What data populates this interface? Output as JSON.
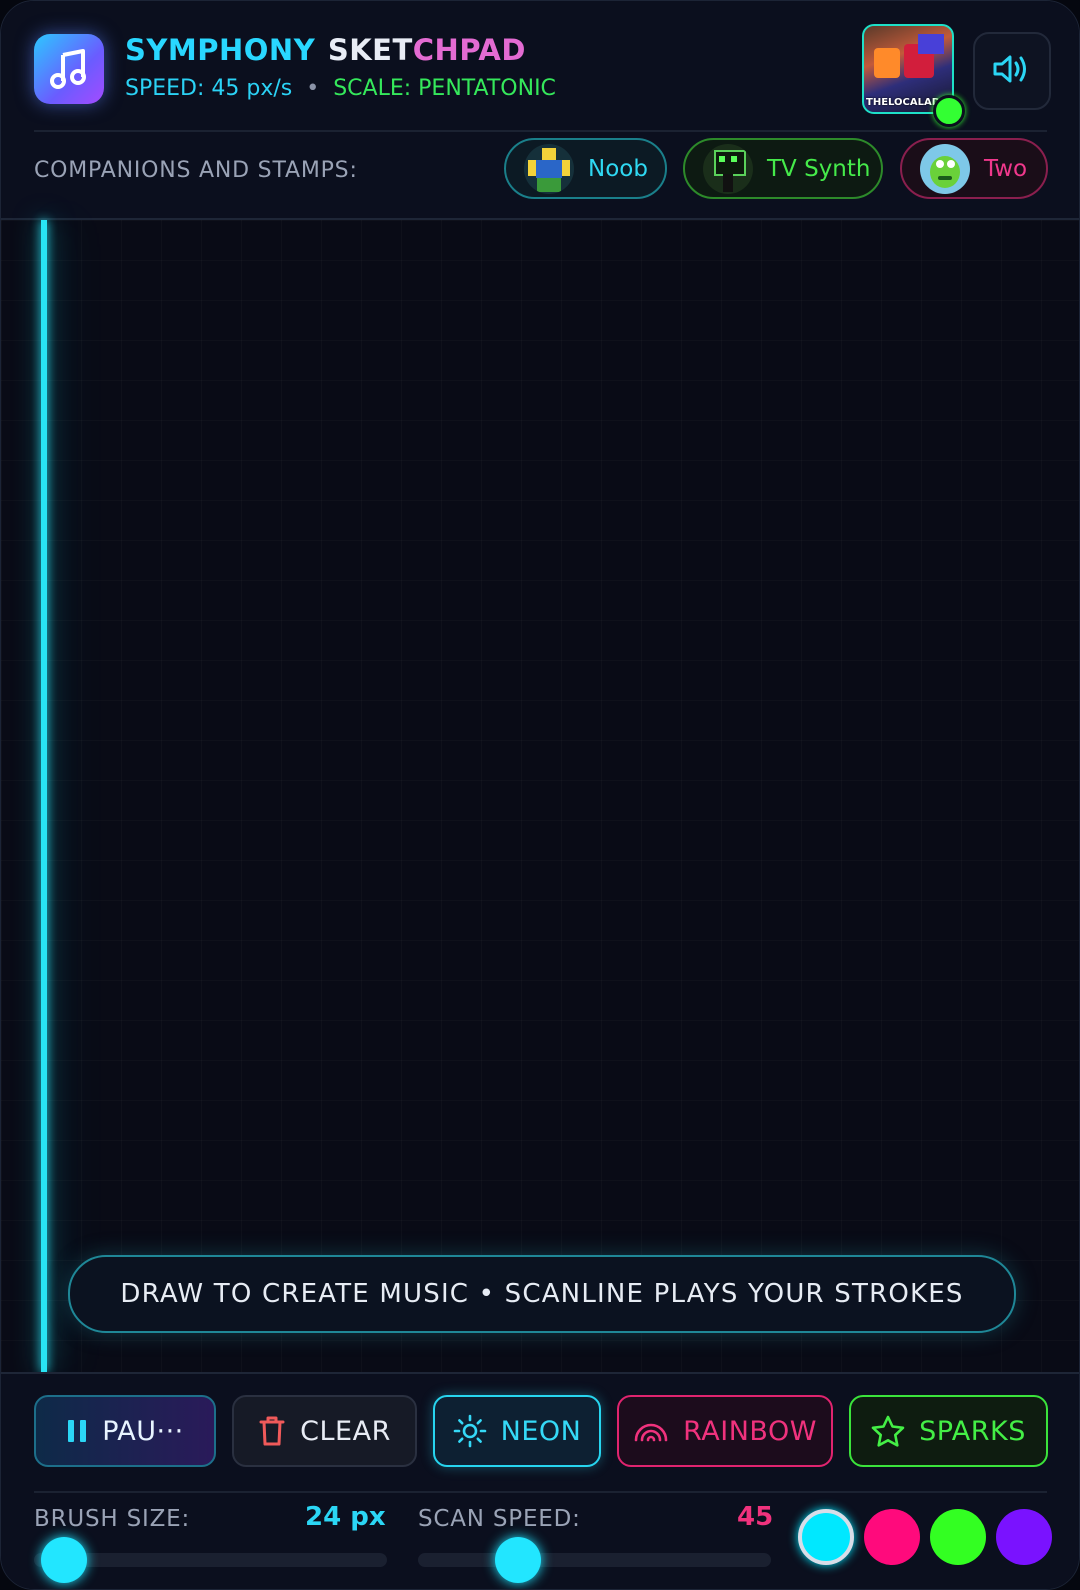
{
  "header": {
    "title_part1": "SYMPHONY",
    "title_part2": "SKET",
    "title_part3": "CHPAD",
    "speed": "SPEED: 45 px/s",
    "separator": "•",
    "scale": "SCALE: PENTATONIC",
    "thumbnail_label": "THELOCALADN",
    "app_icon": "music-note-icon",
    "sound_icon": "speaker-icon"
  },
  "companions": {
    "label": "COMPANIONS AND STAMPS:",
    "items": [
      {
        "label": "Noob",
        "color": "#2fd8f2"
      },
      {
        "label": "TV Synth",
        "color": "#45ea4a"
      },
      {
        "label": "Two",
        "color": "#f0388c"
      }
    ]
  },
  "canvas": {
    "hint": "DRAW TO CREATE MUSIC • SCANLINE PLAYS YOUR STROKES"
  },
  "controls": {
    "pause_label": "PAU···",
    "clear_label": "CLEAR",
    "neon_label": "NEON",
    "rainbow_label": "RAINBOW",
    "sparks_label": "SPARKS"
  },
  "brush": {
    "label": "BRUSH SIZE:",
    "value_text": "24  px",
    "value": 24
  },
  "scan": {
    "label": "SCAN SPEED:",
    "value_text": "45",
    "value": 45
  },
  "colors": {
    "accent": "#29d7ff",
    "swatches": [
      "#00e8ff",
      "#ff0a7c",
      "#33ff22",
      "#7a12ff"
    ],
    "selected_swatch": 0
  }
}
